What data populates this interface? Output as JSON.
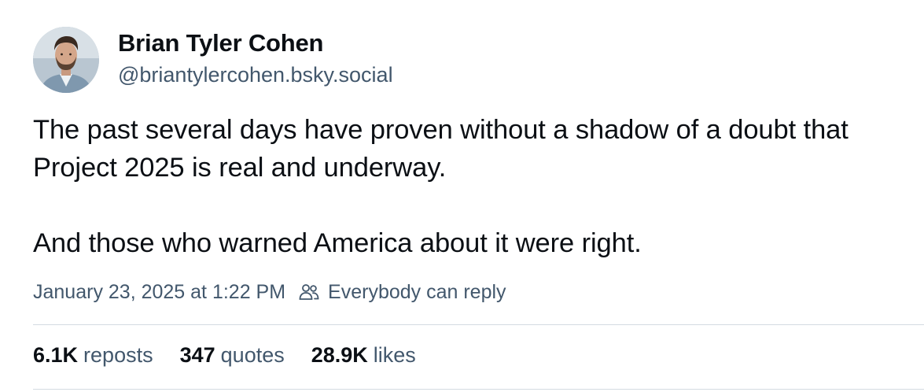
{
  "author": {
    "name": "Brian Tyler Cohen",
    "handle": "@briantylercohen.bsky.social",
    "avatar_icon": "profile-photo"
  },
  "post": {
    "paragraphs": [
      "The past several days have proven without a shadow of a doubt that Project 2025 is real and underway.",
      "And those who warned America about it were right."
    ],
    "timestamp": "January 23, 2025 at 1:22 PM",
    "reply_setting": "Everybody can reply",
    "reply_icon": "people-icon"
  },
  "stats": {
    "reposts": {
      "count": "6.1K",
      "label": "reposts"
    },
    "quotes": {
      "count": "347",
      "label": "quotes"
    },
    "likes": {
      "count": "28.9K",
      "label": "likes"
    }
  },
  "colors": {
    "text": "#0b0f14",
    "muted": "#42576c",
    "divider": "#d4dbe2",
    "background": "#ffffff"
  }
}
